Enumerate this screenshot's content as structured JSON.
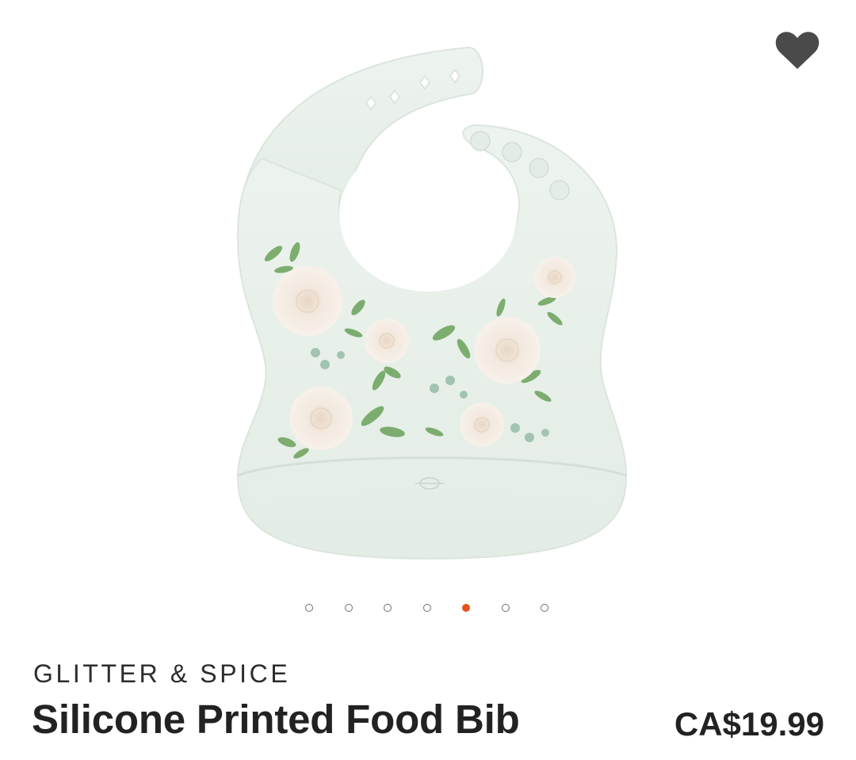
{
  "product": {
    "brand": "GLITTER & SPICE",
    "title": "Silicone Printed Food Bib",
    "price": "CA$19.99",
    "image_icon": "silicone-bib-floral-image"
  },
  "favorite": {
    "icon": "heart-icon",
    "color": "#4a4a4a"
  },
  "carousel": {
    "count": 7,
    "active_index": 4,
    "active_color": "#e8511c",
    "inactive_color": "#6e6e6e"
  },
  "colors": {
    "bib": "#eaf1ec",
    "bib_shadow": "#dce6df",
    "leaf": "#6aa25a",
    "rose": "#f4ece2"
  }
}
